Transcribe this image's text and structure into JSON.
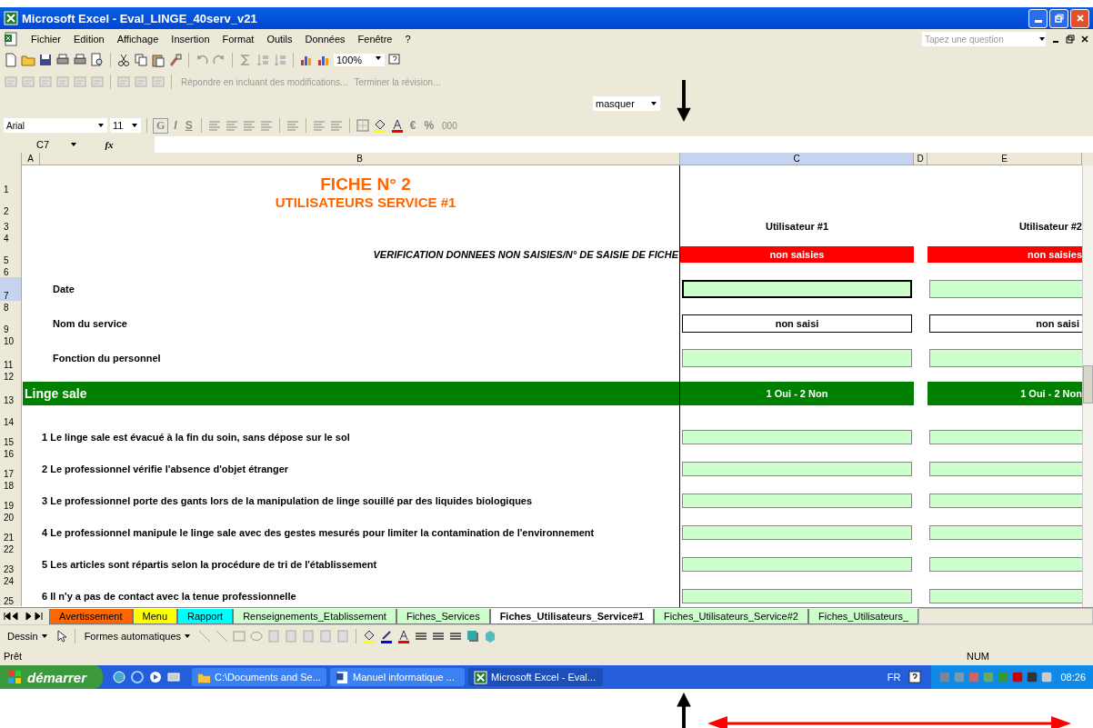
{
  "window": {
    "title": "Microsoft Excel - Eval_LINGE_40serv_v21"
  },
  "menu": [
    "Fichier",
    "Edition",
    "Affichage",
    "Insertion",
    "Format",
    "Outils",
    "Données",
    "Fenêtre",
    "?"
  ],
  "question_box": {
    "placeholder": "Tapez une question"
  },
  "standard_toolbar": {
    "zoom": "100%"
  },
  "review_toolbar": {
    "reply": "Répondre en incluant des modifications...",
    "end": "Terminer la révision..."
  },
  "custom_toolbar": {
    "dropdown": "masquer"
  },
  "format_toolbar": {
    "font": "Arial",
    "size": "11",
    "buttons": [
      "G",
      "I",
      "S"
    ],
    "currency": "€",
    "percent": "%",
    "thousands": "000"
  },
  "formula_bar": {
    "cell": "C7",
    "fx": "fx"
  },
  "columns": [
    {
      "label": "A",
      "selected": false
    },
    {
      "label": "B",
      "selected": false
    },
    {
      "label": "C",
      "selected": true
    },
    {
      "label": "D",
      "selected": false
    },
    {
      "label": "E",
      "selected": false
    }
  ],
  "rows": [
    {
      "num": "1",
      "kind": "title",
      "label": "FICHE N° 2",
      "selected": false
    },
    {
      "num": "2",
      "kind": "subtitle",
      "label": "UTILISATEURS SERVICE #1",
      "selected": false
    },
    {
      "num": "3",
      "kind": "user-header",
      "c": "Utilisateur #1",
      "e": "Utilisateur #2",
      "selected": false
    },
    {
      "num": "4",
      "kind": "spacer",
      "selected": false
    },
    {
      "num": "5",
      "kind": "status",
      "label": "VERIFICATION DONNEES NON SAISIES/N° DE SAISIE DE FICHE",
      "c": "non saisies",
      "e": "non saisies",
      "selected": false
    },
    {
      "num": "6",
      "kind": "spacer",
      "selected": false
    },
    {
      "num": "7",
      "kind": "input",
      "label": "Date",
      "selected": true
    },
    {
      "num": "8",
      "kind": "spacer",
      "selected": false
    },
    {
      "num": "9",
      "kind": "value",
      "label": "Nom du service",
      "c": "non saisi",
      "e": "non saisi",
      "selected": false
    },
    {
      "num": "10",
      "kind": "spacer",
      "selected": false
    },
    {
      "num": "11",
      "kind": "input",
      "label": "Fonction du personnel",
      "selected": false
    },
    {
      "num": "12",
      "kind": "spacer",
      "selected": false
    },
    {
      "num": "13",
      "kind": "section",
      "label": "Linge sale",
      "c": "1 Oui - 2 Non",
      "e": "1 Oui - 2 Non",
      "selected": false
    },
    {
      "num": "14",
      "kind": "spacer-tall",
      "selected": false
    },
    {
      "num": "15",
      "kind": "question",
      "label": "1 Le linge sale est évacué à la fin du soin, sans dépose sur le sol",
      "selected": false
    },
    {
      "num": "16",
      "kind": "spacer",
      "selected": false
    },
    {
      "num": "17",
      "kind": "question",
      "label": "2 Le professionnel vérifie l'absence d'objet étranger",
      "selected": false
    },
    {
      "num": "18",
      "kind": "spacer",
      "selected": false
    },
    {
      "num": "19",
      "kind": "question",
      "label": "3 Le professionnel porte des gants lors de la manipulation de linge souillé par des liquides biologiques",
      "selected": false
    },
    {
      "num": "20",
      "kind": "spacer",
      "selected": false
    },
    {
      "num": "21",
      "kind": "question",
      "label": "4 Le professionnel manipule le linge sale avec des gestes mesurés pour limiter la contamination de l'environnement",
      "selected": false
    },
    {
      "num": "22",
      "kind": "spacer",
      "selected": false
    },
    {
      "num": "23",
      "kind": "question",
      "label": "5 Les articles sont répartis selon la procédure de tri de l'établissement",
      "selected": false
    },
    {
      "num": "24",
      "kind": "spacer",
      "selected": false
    },
    {
      "num": "25",
      "kind": "question",
      "label": "6 Il n'y a pas de contact avec la tenue professionnelle",
      "selected": false
    }
  ],
  "sheet_tabs": [
    {
      "label": "Avertissement",
      "color": "#ff6600",
      "selected": false
    },
    {
      "label": "Menu",
      "color": "#ffff00",
      "selected": false
    },
    {
      "label": "Rapport",
      "color": "#00ffff",
      "selected": false
    },
    {
      "label": "Renseignements_Etablissement",
      "color": "#ccffcc",
      "selected": false
    },
    {
      "label": "Fiches_Services",
      "color": "#ccffcc",
      "selected": false
    },
    {
      "label": "Fiches_Utilisateurs_Service#1",
      "color": "#ffffff",
      "selected": true
    },
    {
      "label": "Fiches_Utilisateurs_Service#2",
      "color": "#ccffcc",
      "selected": false
    },
    {
      "label": "Fiches_Utilisateurs_",
      "color": "#ccffcc",
      "selected": false
    }
  ],
  "drawing_toolbar": {
    "draw": "Dessin",
    "autoshapes": "Formes automatiques"
  },
  "status_bar": {
    "status": "Prêt",
    "num": "NUM"
  },
  "taskbar": {
    "start": "démarrer",
    "items": [
      {
        "label": "C:\\Documents and Se...",
        "kind": "folder",
        "selected": false
      },
      {
        "label": "Manuel informatique ...",
        "kind": "word",
        "selected": false
      },
      {
        "label": "Microsoft Excel - Eval...",
        "kind": "excel",
        "selected": true
      }
    ],
    "language": "FR",
    "clock": "08:26"
  }
}
